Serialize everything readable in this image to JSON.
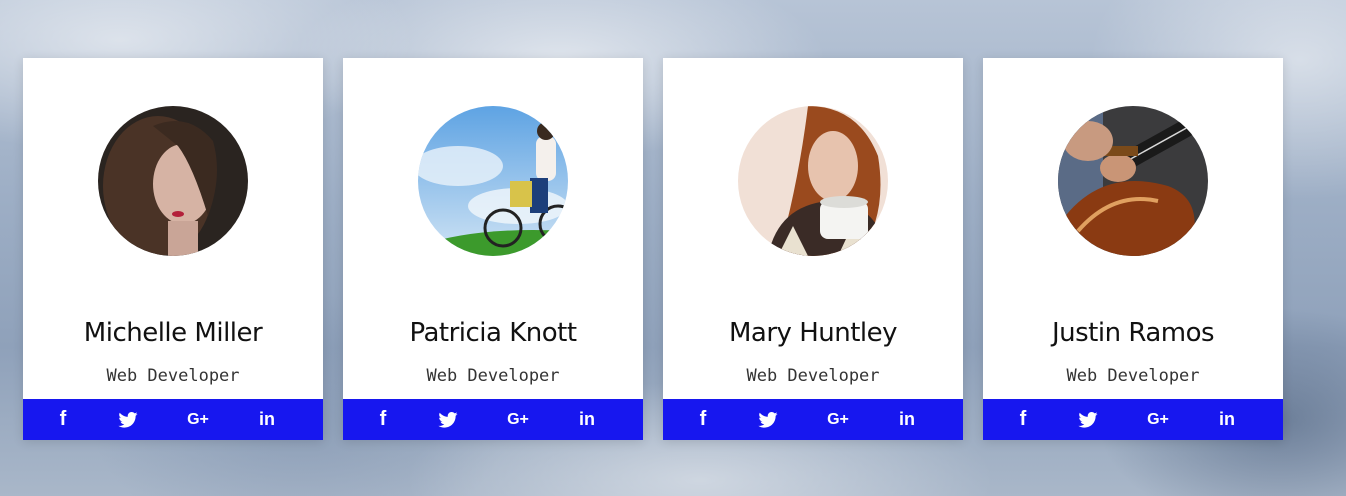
{
  "cards": [
    {
      "name": "Michelle Miller",
      "role": "Web Developer"
    },
    {
      "name": "Patricia Knott",
      "role": "Web Developer"
    },
    {
      "name": "Mary Huntley",
      "role": "Web Developer"
    },
    {
      "name": "Justin Ramos",
      "role": "Web Developer"
    }
  ],
  "social_icons": [
    "facebook-icon",
    "twitter-icon",
    "google-plus-icon",
    "linkedin-icon"
  ],
  "colors": {
    "social_bar": "#1717ef",
    "card": "#ffffff"
  }
}
